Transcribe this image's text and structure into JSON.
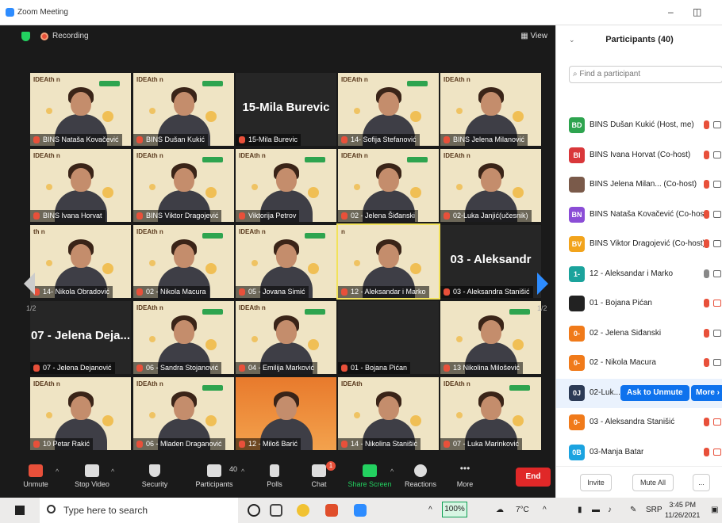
{
  "window": {
    "title": "Zoom Meeting"
  },
  "topbar": {
    "recording": "Recording",
    "view": "View"
  },
  "pager": {
    "left": "1/2",
    "right": "1/2"
  },
  "tiles": [
    {
      "label": "BINS Nataša Kovačević",
      "type": "video",
      "logo": "IDEAth n",
      "badge": true
    },
    {
      "label": "BINS Dušan Kukić",
      "type": "video",
      "logo": "IDEAth n",
      "badge": true
    },
    {
      "label": "15-Mila Burevic",
      "type": "dark",
      "big": "15-Mila Burevic"
    },
    {
      "label": "14- Sofija Stefanović",
      "type": "video",
      "logo": "IDEAth n",
      "badge": true
    },
    {
      "label": "BINS Jelena Milanović",
      "type": "video",
      "logo": "IDEAth n",
      "badge": false
    },
    {
      "label": "BINS Ivana Horvat",
      "type": "video",
      "logo": "IDEAth n",
      "badge": false
    },
    {
      "label": "BINS Viktor Dragojević",
      "type": "video",
      "logo": "IDEAth n",
      "badge": true
    },
    {
      "label": "Viktorija Petrov",
      "type": "video",
      "logo": "IDEAth n",
      "badge": true
    },
    {
      "label": "02 - Jelena Šiđanski",
      "type": "video",
      "logo": "IDEAth n",
      "badge": true
    },
    {
      "label": "02-Luka Janjić(učesnik)",
      "type": "video",
      "logo": "IDEAth n",
      "badge": false
    },
    {
      "label": "14- Nikola Obradović",
      "type": "video",
      "logo": "th n",
      "badge": false
    },
    {
      "label": "02 - Nikola Macura",
      "type": "video",
      "logo": "IDEAth n",
      "badge": true
    },
    {
      "label": "05 - Jovana Simić",
      "type": "video",
      "logo": "IDEAth n",
      "badge": true
    },
    {
      "label": "12 - Aleksandar i Marko",
      "type": "video",
      "logo": "n",
      "badge": false
    },
    {
      "label": "03 - Aleksandra Stanišić",
      "type": "dark",
      "big": "03 - Aleksandr"
    },
    {
      "label": "07 - Jelena Dejanović",
      "type": "dark",
      "big": "07 - Jelena Deja..."
    },
    {
      "label": "06 - Sandra Stojanović",
      "type": "video",
      "logo": "IDEAth n",
      "badge": true
    },
    {
      "label": "04 - Emilija Marković",
      "type": "video",
      "logo": "IDEAth n",
      "badge": true
    },
    {
      "label": "01 - Bojana Pićan",
      "type": "dark",
      "big": ""
    },
    {
      "label": "13 Nikolina Milošević",
      "type": "video",
      "logo": "",
      "badge": true
    },
    {
      "label": "10 Petar Rakić",
      "type": "video",
      "logo": "IDEAth n",
      "badge": false
    },
    {
      "label": "06 - Mladen Draganović",
      "type": "video",
      "logo": "IDEAth n",
      "badge": true
    },
    {
      "label": "12 - Miloš Barić",
      "type": "orange",
      "logo": "",
      "badge": false
    },
    {
      "label": "14 - Nikolina Stanišić",
      "type": "video",
      "logo": "IDEAth",
      "badge": false
    },
    {
      "label": "07 - Luka Marinković",
      "type": "video",
      "logo": "IDEAth n",
      "badge": true
    }
  ],
  "toolbar": {
    "unmute": "Unmute",
    "stop_video": "Stop Video",
    "security": "Security",
    "participants": "Participants",
    "participants_count": "40",
    "polls": "Polls",
    "chat": "Chat",
    "chat_badge": "1",
    "share_screen": "Share Screen",
    "reactions": "Reactions",
    "more": "More",
    "end": "End"
  },
  "panel": {
    "title": "Participants (40)",
    "search_placeholder": "Find a participant",
    "rows": [
      {
        "initials": "BD",
        "color": "#2ea44f",
        "name": "BINS Dušan Kukić (Host, me)",
        "mic": "red",
        "cam": "gray"
      },
      {
        "initials": "BI",
        "color": "#d9373a",
        "name": "BINS Ivana Horvat (Co-host)",
        "mic": "red",
        "cam": "gray"
      },
      {
        "initials": "",
        "color": "#7a5a4a",
        "name": "BINS Jelena Milan... (Co-host)",
        "mic": "red",
        "cam": "gray"
      },
      {
        "initials": "BN",
        "color": "#8b4dd6",
        "name": "BINS Nataša Kovačević (Co-host)",
        "mic": "red",
        "cam": "gray"
      },
      {
        "initials": "BV",
        "color": "#f2a41c",
        "name": "BINS Viktor Dragojević (Co-host)",
        "mic": "red",
        "cam": "gray"
      },
      {
        "initials": "1-",
        "color": "#1ba39c",
        "name": "12 - Aleksandar i Marko",
        "mic": "gray",
        "cam": "gray"
      },
      {
        "initials": "",
        "color": "#222222",
        "name": "01 - Bojana Pićan",
        "mic": "red",
        "cam": "red"
      },
      {
        "initials": "0-",
        "color": "#f07a1a",
        "name": "02 - Jelena Šiđanski",
        "mic": "red",
        "cam": "gray"
      },
      {
        "initials": "0-",
        "color": "#f07a1a",
        "name": "02 - Nikola Macura",
        "mic": "red",
        "cam": "gray"
      },
      {
        "initials": "0J",
        "color": "#2b3a55",
        "name": "02-Luk...",
        "mic": "",
        "cam": ""
      },
      {
        "initials": "0-",
        "color": "#f07a1a",
        "name": "03 - Aleksandra Stanišić",
        "mic": "red",
        "cam": "red"
      },
      {
        "initials": "0B",
        "color": "#1ba3e0",
        "name": "03-Manja Batar",
        "mic": "red",
        "cam": "red"
      }
    ],
    "ask_to_unmute": "Ask to Unmute",
    "more": "More",
    "invite": "Invite",
    "mute_all": "Mute All",
    "ellipsis": "..."
  },
  "taskbar": {
    "search_placeholder": "Type here to search",
    "zoom_level": "100%",
    "temperature": "7°C",
    "language": "SRP",
    "time": "3:45 PM",
    "date": "11/26/2021"
  }
}
